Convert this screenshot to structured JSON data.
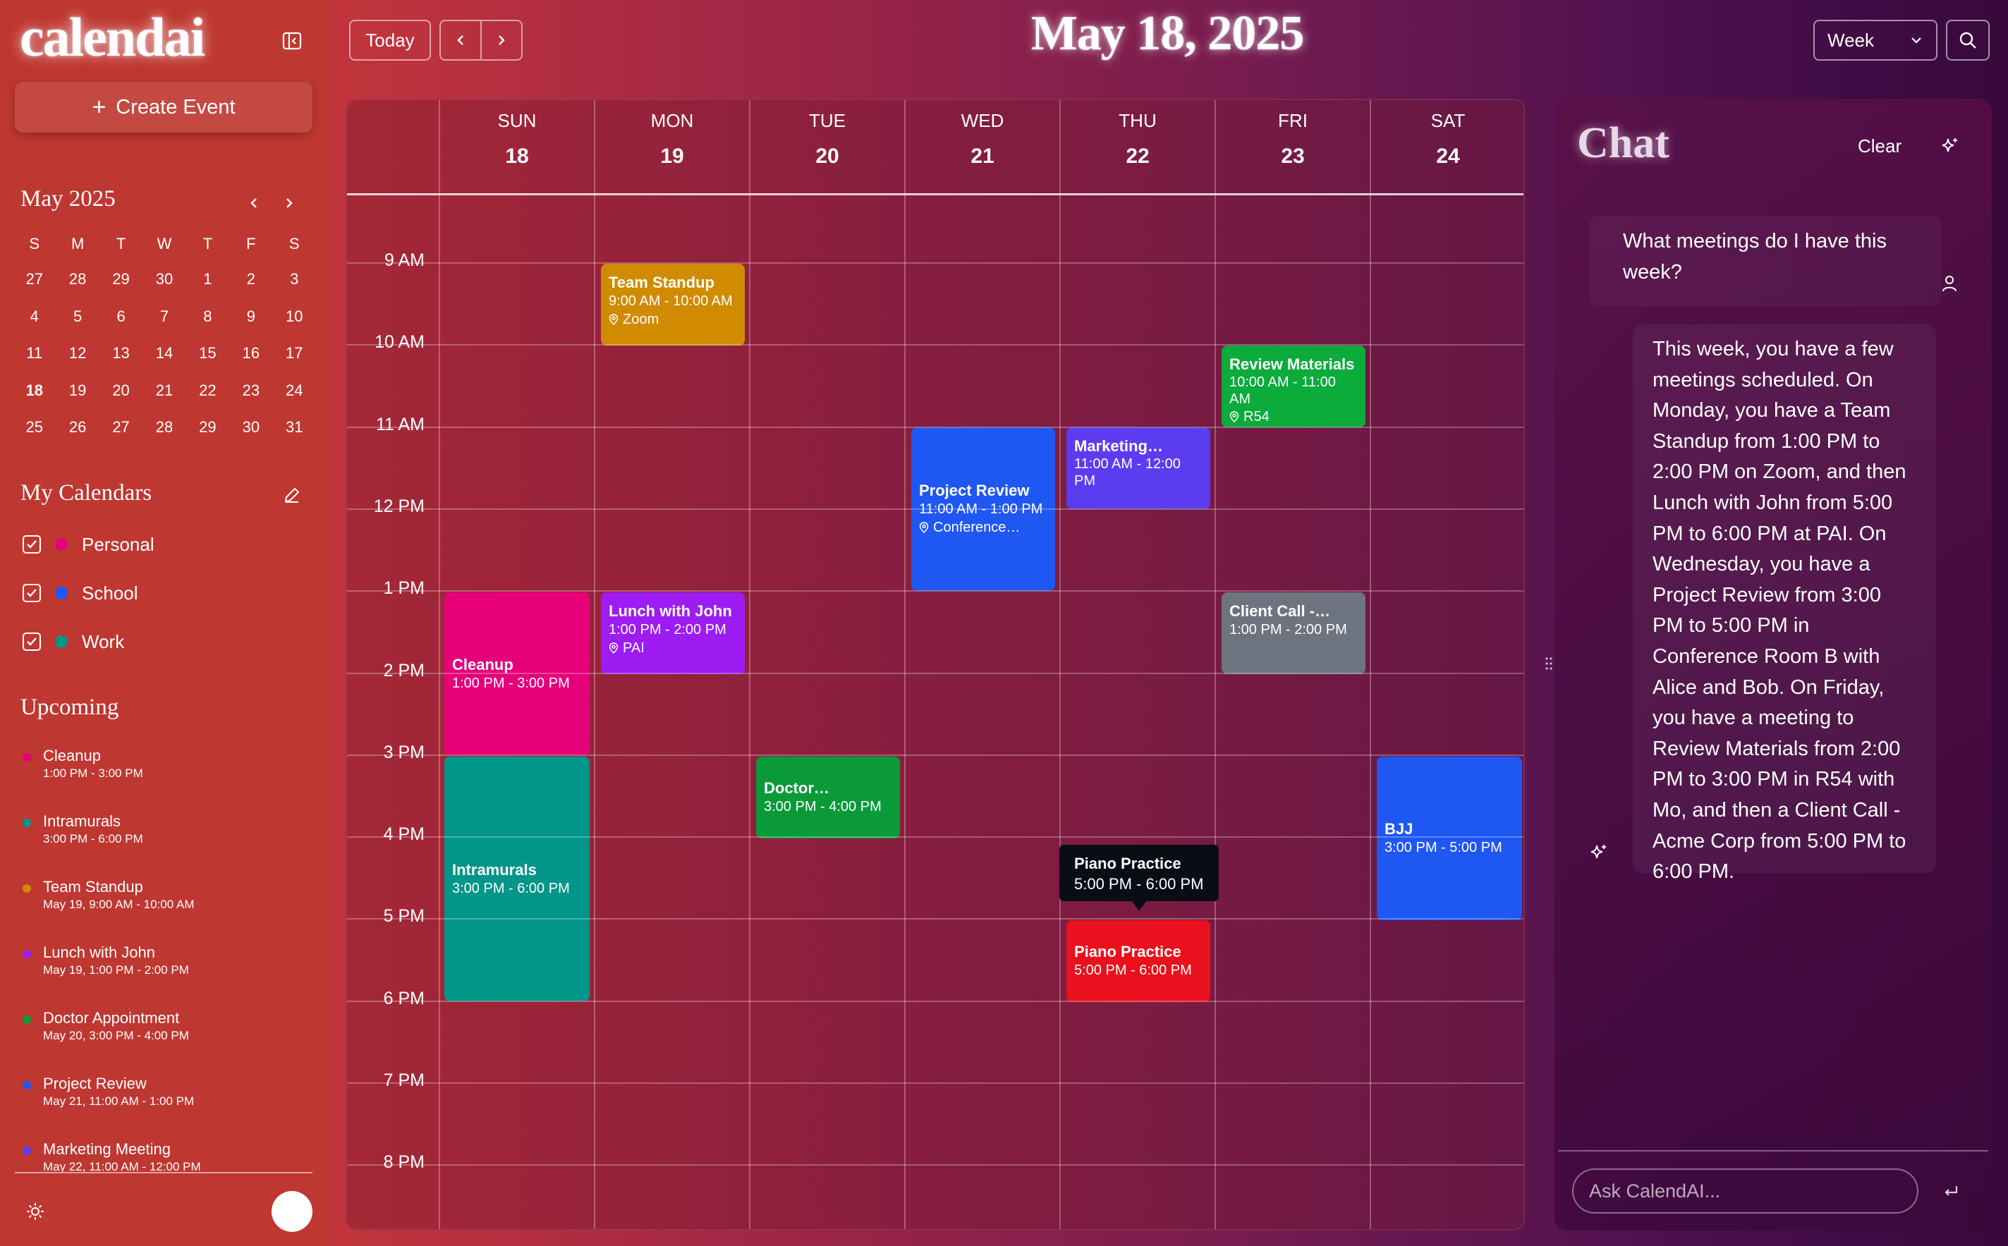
{
  "app": {
    "logo": "calendai",
    "title": "May 18, 2025"
  },
  "sidebar": {
    "create_label": "Create Event",
    "month_label": "May 2025",
    "weekday_initials": [
      "S",
      "M",
      "T",
      "W",
      "T",
      "F",
      "S"
    ],
    "mini_days": [
      [
        "27",
        "28",
        "29",
        "30",
        "1",
        "2",
        "3"
      ],
      [
        "4",
        "5",
        "6",
        "7",
        "8",
        "9",
        "10"
      ],
      [
        "11",
        "12",
        "13",
        "14",
        "15",
        "16",
        "17"
      ],
      [
        "18",
        "19",
        "20",
        "21",
        "22",
        "23",
        "24"
      ],
      [
        "25",
        "26",
        "27",
        "28",
        "29",
        "30",
        "31"
      ]
    ],
    "my_calendars_label": "My Calendars",
    "calendars": [
      {
        "name": "Personal",
        "color": "#e5007a"
      },
      {
        "name": "School",
        "color": "#1f57f2"
      },
      {
        "name": "Work",
        "color": "#009688"
      }
    ],
    "upcoming_label": "Upcoming",
    "upcoming": [
      {
        "title": "Cleanup",
        "time": "1:00 PM - 3:00 PM",
        "color": "#e5007a"
      },
      {
        "title": "Intramurals",
        "time": "3:00 PM - 6:00 PM",
        "color": "#009688"
      },
      {
        "title": "Team Standup",
        "time": "May 19, 9:00 AM - 10:00 AM",
        "color": "#d08b00"
      },
      {
        "title": "Lunch with John",
        "time": "May 19, 1:00 PM - 2:00 PM",
        "color": "#9c1cf2"
      },
      {
        "title": "Doctor Appointment",
        "time": "May 20, 3:00 PM - 4:00 PM",
        "color": "#0b9a3a"
      },
      {
        "title": "Project Review",
        "time": "May 21, 11:00 AM - 1:00 PM",
        "color": "#1f57f2"
      },
      {
        "title": "Marketing Meeting",
        "time": "May 22, 11:00 AM - 12:00 PM",
        "color": "#5b3cf0"
      }
    ]
  },
  "toolbar": {
    "today_label": "Today",
    "view_label": "Week"
  },
  "week": {
    "days": [
      {
        "name": "SUN",
        "num": "18"
      },
      {
        "name": "MON",
        "num": "19"
      },
      {
        "name": "TUE",
        "num": "20"
      },
      {
        "name": "WED",
        "num": "21"
      },
      {
        "name": "THU",
        "num": "22"
      },
      {
        "name": "FRI",
        "num": "23"
      },
      {
        "name": "SAT",
        "num": "24"
      }
    ],
    "hours": [
      "9 AM",
      "10 AM",
      "11 AM",
      "12 PM",
      "1 PM",
      "2 PM",
      "3 PM",
      "4 PM",
      "5 PM",
      "6 PM",
      "7 PM",
      "8 PM"
    ]
  },
  "events": {
    "team_standup": {
      "title": "Team Standup",
      "time": "9:00 AM - 10:00 AM",
      "location": "Zoom",
      "color": "#d08b00"
    },
    "review_materials": {
      "title": "Review Materials",
      "time": "10:00 AM - 11:00 AM",
      "location": "R54",
      "color": "#0bab3c"
    },
    "project_review": {
      "title": "Project Review",
      "time": "11:00 AM - 1:00 PM",
      "location": "Conference…",
      "color": "#1f57f2"
    },
    "marketing": {
      "title": "Marketing…",
      "time": "11:00 AM - 12:00 PM",
      "color": "#5b3cf0"
    },
    "cleanup": {
      "title": "Cleanup",
      "time": "1:00 PM - 3:00 PM",
      "color": "#e5007a"
    },
    "lunch_john": {
      "title": "Lunch with John",
      "time": "1:00 PM - 2:00 PM",
      "location": "PAI",
      "color": "#9c1cf2"
    },
    "client_call": {
      "title": "Client Call -…",
      "time": "1:00 PM - 2:00 PM",
      "color": "#6e7380"
    },
    "intramurals": {
      "title": "Intramurals",
      "time": "3:00 PM - 6:00 PM",
      "color": "#009688"
    },
    "doctor": {
      "title": "Doctor…",
      "time": "3:00 PM - 4:00 PM",
      "color": "#0b9a3a"
    },
    "bjj": {
      "title": "BJJ",
      "time": "3:00 PM - 5:00 PM",
      "color": "#1f57f2"
    },
    "piano": {
      "title": "Piano Practice",
      "time": "5:00 PM - 6:00 PM",
      "color": "#e8111d"
    }
  },
  "tooltip": {
    "title": "Piano Practice",
    "time": "5:00 PM - 6:00 PM"
  },
  "chat": {
    "title": "Chat",
    "clear_label": "Clear",
    "user_message": "What meetings do I have this week?",
    "ai_message": "This week, you have a few meetings scheduled. On Monday, you have a Team Standup from 1:00 PM to 2:00 PM on Zoom, and then Lunch with John from 5:00 PM to 6:00 PM at PAI. On Wednesday, you have a Project Review from 3:00 PM to 5:00 PM in Conference Room B with Alice and Bob. On Friday, you have a meeting to Review Materials from 2:00 PM to 3:00 PM in R54 with Mo, and then a Client Call - Acme Corp from 5:00 PM to 6:00 PM.",
    "input_placeholder": "Ask CalendAI..."
  }
}
